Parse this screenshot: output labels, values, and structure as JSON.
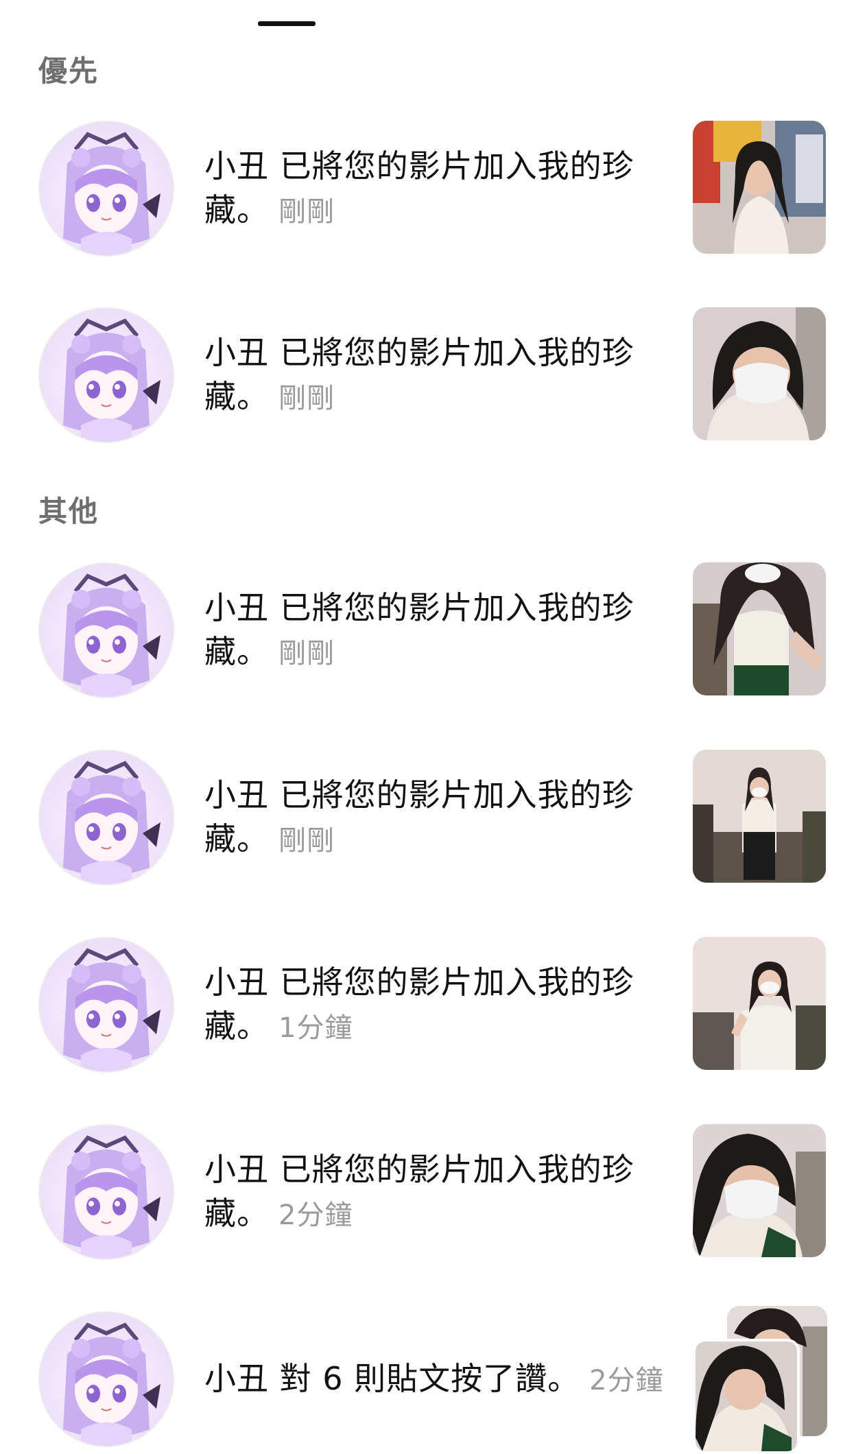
{
  "sections": {
    "priority": "優先",
    "other": "其他"
  },
  "notifications": [
    {
      "user": "小丑",
      "message": "已將您的影片加入我的珍藏。",
      "time": "剛剛"
    },
    {
      "user": "小丑",
      "message": "已將您的影片加入我的珍藏。",
      "time": "剛剛"
    },
    {
      "user": "小丑",
      "message": "已將您的影片加入我的珍藏。",
      "time": "剛剛"
    },
    {
      "user": "小丑",
      "message": "已將您的影片加入我的珍藏。",
      "time": "剛剛"
    },
    {
      "user": "小丑",
      "message": "已將您的影片加入我的珍藏。",
      "time": "1分鐘"
    },
    {
      "user": "小丑",
      "message": "已將您的影片加入我的珍藏。",
      "time": "2分鐘"
    },
    {
      "user": "小丑",
      "message": "對 6 則貼文按了讚。",
      "time": "2分鐘"
    }
  ],
  "colors": {
    "section_title": "#6e6e6e",
    "timestamp": "#9a9a9a",
    "avatar_purple": "#b79ce8"
  }
}
